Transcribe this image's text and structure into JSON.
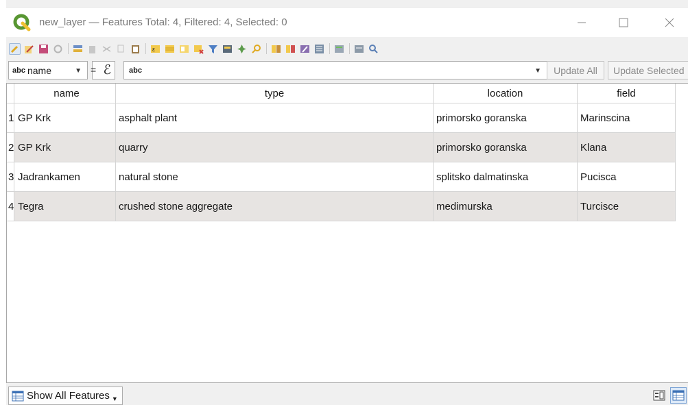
{
  "window": {
    "title": "new_layer — Features Total: 4, Filtered: 4, Selected: 0",
    "app_icon": "qgis-logo-icon"
  },
  "toolbar": {
    "icons": [
      "toggle-editing-icon",
      "toggle-multi-edit-icon",
      "save-edits-icon",
      "reload-table-icon",
      "add-feature-icon",
      "delete-selected-icon",
      "cut-icon",
      "copy-icon",
      "paste-icon",
      "select-by-expression-icon",
      "select-all-icon",
      "invert-selection-icon",
      "deselect-all-icon",
      "filter-select-icon",
      "move-selection-top-icon",
      "pan-to-selected-icon",
      "zoom-to-selected-icon",
      "new-field-icon",
      "delete-field-icon",
      "organize-columns-icon",
      "field-calculator-icon",
      "conditional-formatting-icon",
      "actions-icon",
      "dock-table-icon"
    ]
  },
  "filter": {
    "field_type_tag": "abc",
    "field_name": "name",
    "equals": "=",
    "expression_symbol": "ℰ",
    "value_type_tag": "abc",
    "value": "",
    "update_all_label": "Update All",
    "update_selected_label": "Update Selected"
  },
  "table": {
    "columns": [
      "name",
      "type",
      "location",
      "field"
    ],
    "rows": [
      {
        "n": "1",
        "name": "GP Krk",
        "type": "asphalt plant",
        "location": "primorsko goranska",
        "field": "Marinscina"
      },
      {
        "n": "2",
        "name": "GP Krk",
        "type": "quarry",
        "location": "primorsko goranska",
        "field": "Klana"
      },
      {
        "n": "3",
        "name": "Jadrankamen",
        "type": "natural stone",
        "location": "splitsko dalmatinska",
        "field": "Pucisca"
      },
      {
        "n": "4",
        "name": "Tegra",
        "type": "crushed stone aggregate",
        "location": "medimurska",
        "field": "Turcisce"
      }
    ]
  },
  "bottom": {
    "show_features_label": "Show All Features"
  },
  "colors": {
    "alt_row": "#e7e4e2",
    "qgis_green": "#589632",
    "qgis_yellow": "#f0c132"
  }
}
